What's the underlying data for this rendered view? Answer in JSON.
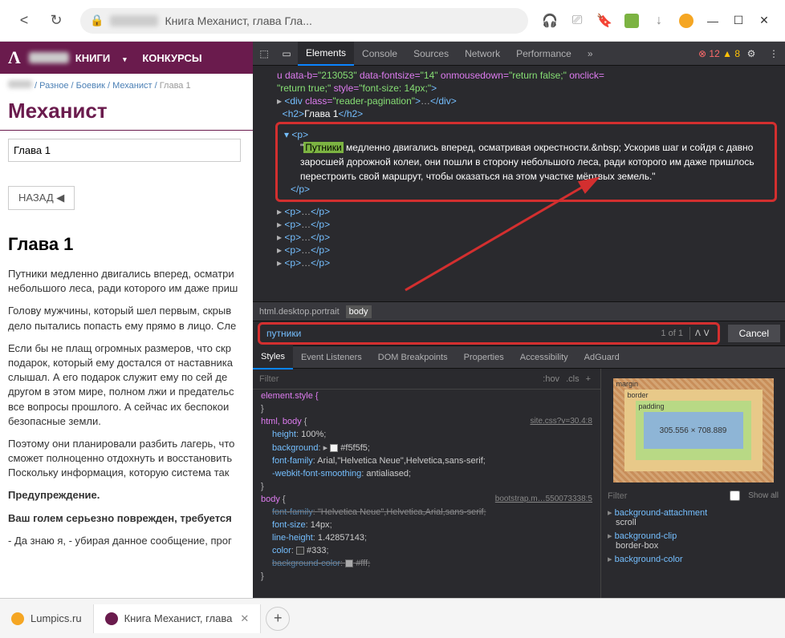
{
  "browser": {
    "title": "Книга Механист, глава Гла...",
    "back": "<",
    "refresh": "↻"
  },
  "site": {
    "nav1": "КНИГИ",
    "nav2": "КОНКУРСЫ",
    "breadcrumb": {
      "p1": "Разное",
      "p2": "Боевик",
      "p3": "Механист",
      "p4": "Глава 1",
      "sep": " / "
    },
    "title": "Механист",
    "chapter": "Глава 1",
    "back_btn": "НАЗАД",
    "h1": "Глава 1",
    "p1": "Путники медленно двигались вперед, осматри небольшого леса, ради которого им даже приш",
    "p2": "Голову мужчины, который шел первым, скрыв дело пытались попасть ему прямо в лицо. Сле",
    "p3": "Если бы не плащ огромных размеров, что скр подарок, который ему достался от наставника слышал. А его подарок служит ему по сей де другом в этом мире, полном лжи и предательс все вопросы прошлого. А сейчас их беспокои безопасные земли.",
    "p4": "Поэтому они планировали разбить лагерь, что сможет полноценно отдохнуть и восстановить Поскольку информация, которую система так",
    "p5": "Предупреждение.",
    "p6": "Ваш голем серьезно поврежден, требуется",
    "p7": "- Да знаю я, - убирая данное сообщение, прог"
  },
  "devtools": {
    "tabs": {
      "elements": "Elements",
      "console": "Console",
      "sources": "Sources",
      "network": "Network",
      "performance": "Performance"
    },
    "errors": "12",
    "warnings": "8",
    "dom": {
      "l1_pre": "u data-b=",
      "l1_v1": "\"213053\"",
      "l1_a2": "data-fontsize=",
      "l1_v2": "\"14\"",
      "l1_a3": "onmousedown=",
      "l1_v3": "\"return false;\"",
      "l1_a4": "onclick=",
      "l2": "\"return true;\"",
      "l2_a": "style=",
      "l2_v": "\"font-size: 14px;\"",
      "l3_tag": "div",
      "l3_a": "class=",
      "l3_v": "\"reader-pagination\"",
      "l3_close": "</div>",
      "l4_tag": "h2",
      "l4_txt": "Глава 1",
      "l4_close": "</h2>",
      "p_tag": "p",
      "hl_word": "Путники",
      "hl_text": " медленно двигались вперед, осматривая окрестности.&nbsp; Ускорив шаг и сойдя с давно заросшей дорожной колеи, они пошли в сторону небольшого леса, ради которого им даже пришлось перестроить свой маршрут, чтобы оказаться на этом участке мёртвых земель.\"",
      "p_close": "</p>",
      "ellips": "…"
    },
    "crumb1": "html.desktop.portrait",
    "crumb2": "body",
    "search": {
      "value": "путники",
      "count": "1 of 1",
      "cancel": "Cancel"
    },
    "subtabs": {
      "styles": "Styles",
      "ev": "Event Listeners",
      "dom": "DOM Breakpoints",
      "prop": "Properties",
      "acc": "Accessibility",
      "ad": "AdGuard"
    },
    "filter_ph": "Filter",
    "hov": ":hov",
    "cls": ".cls",
    "rules": {
      "r1": "element.style {",
      "r2_sel": "html, body",
      "r2_src": "site.css?v=30.4:8",
      "r2_p1": "height",
      "r2_v1": "100%",
      "r2_p2": "background",
      "r2_v2": "#f5f5f5",
      "r2_p3": "font-family",
      "r2_v3": "Arial,\"Helvetica Neue\",Helvetica,sans-serif",
      "r2_p4": "-webkit-font-smoothing",
      "r2_v4": "antialiased",
      "r3_sel": "body",
      "r3_src": "bootstrap.m…550073338:5",
      "r3_p1": "font-family",
      "r3_v1": "\"Helvetica Neue\",Helvetica,Arial,sans-serif",
      "r3_p2": "font-size",
      "r3_v2": "14px",
      "r3_p3": "line-height",
      "r3_v3": "1.42857143",
      "r3_p4": "color",
      "r3_v4": "#333",
      "r3_p5": "background-color",
      "r3_v5": "#fff",
      "brace_close": "}"
    },
    "box": {
      "margin": "margin",
      "border": "border",
      "padding": "padding",
      "content": "305.556 × 708.889",
      "dash": "–"
    },
    "comp_filter": "Filter",
    "showall": "Show all",
    "comp1": "background-attachment",
    "comp1v": "scroll",
    "comp2": "background-clip",
    "comp2v": "border-box",
    "comp3": "background-color"
  },
  "tabs": {
    "t1": "Lumpics.ru",
    "t2": "Книга Механист, глава"
  }
}
